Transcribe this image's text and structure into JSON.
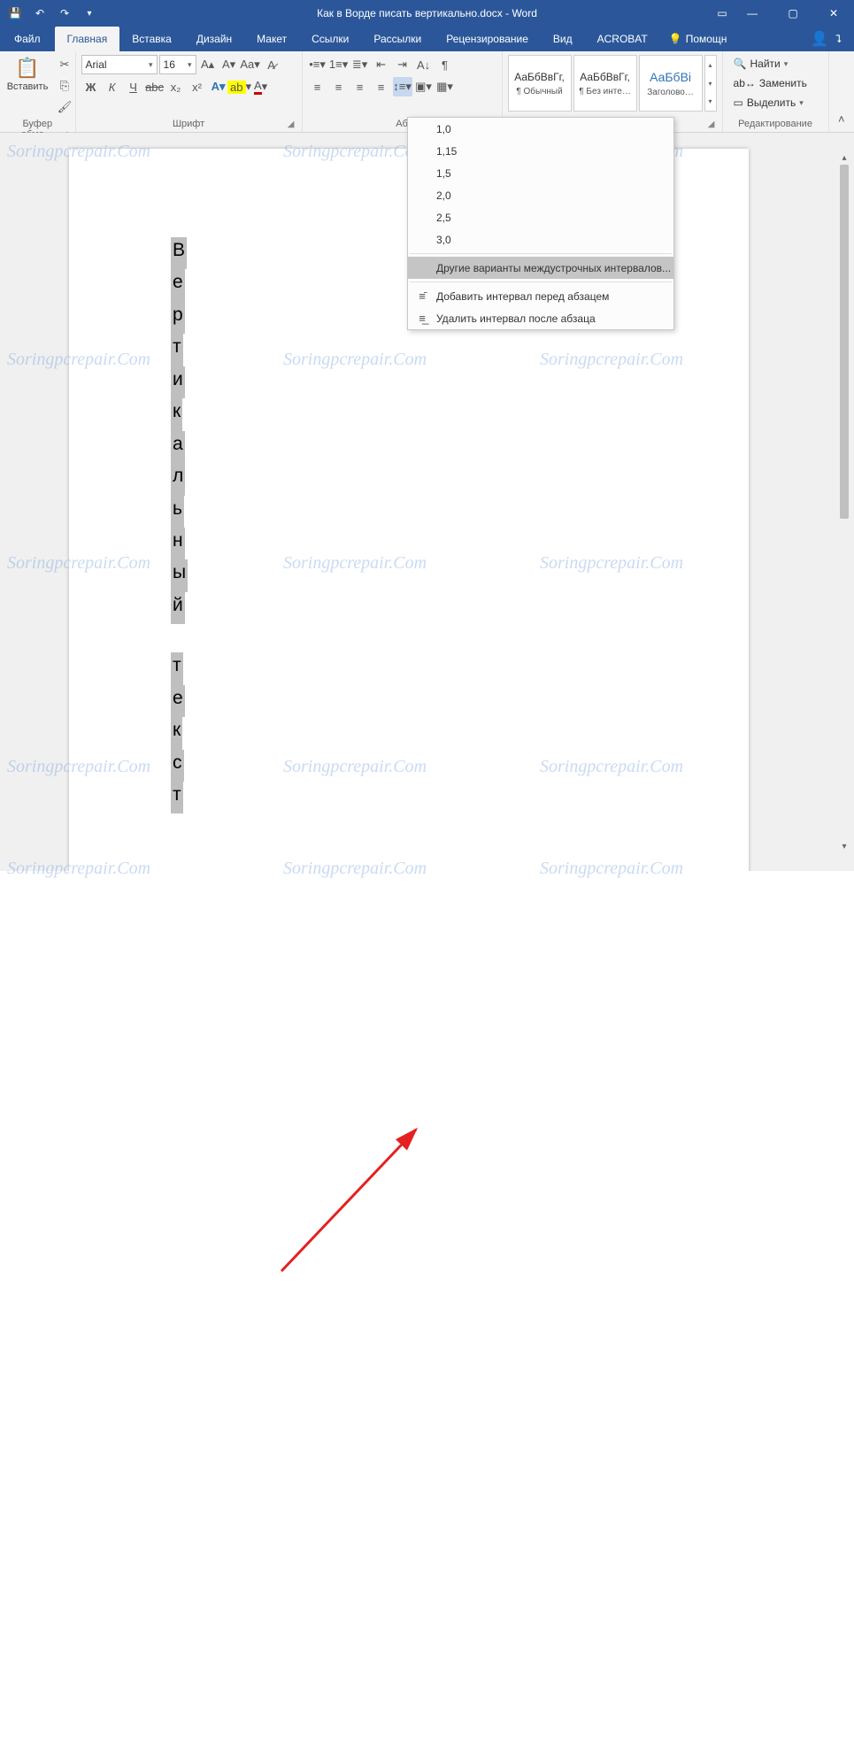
{
  "titlebar": {
    "doc_title": "Как в Ворде писать вертикально.docx - Word"
  },
  "tabs": {
    "file": "Файл",
    "home": "Главная",
    "insert": "Вставка",
    "design": "Дизайн",
    "layout": "Макет",
    "references": "Ссылки",
    "mailings": "Рассылки",
    "review": "Рецензирование",
    "view": "Вид",
    "acrobat": "ACROBAT",
    "tellme": "Помощн"
  },
  "clipboard": {
    "paste": "Вставить",
    "group_label": "Буфер обме…"
  },
  "font": {
    "name": "Arial",
    "size": "16",
    "group_label": "Шрифт",
    "bold": "Ж",
    "italic": "К",
    "underline": "Ч",
    "strike": "abc",
    "sub": "x₂",
    "sup": "x²"
  },
  "paragraph": {
    "group_label": "Аб"
  },
  "styles": {
    "preview": "АаБбВвГг,",
    "normal": "¶ Обычный",
    "nospacing": "¶ Без инте…",
    "heading1": "Заголово…"
  },
  "editing": {
    "find": "Найти",
    "replace": "Заменить",
    "select": "Выделить",
    "group_label": "Редактирование"
  },
  "line_spacing_menu": {
    "options": [
      "1,0",
      "1,15",
      "1,5",
      "2,0",
      "2,5",
      "3,0"
    ],
    "more": "Другие варианты междустрочных интервалов...",
    "add_before": "Добавить интервал перед абзацем",
    "remove_after": "Удалить интервал после абзаца"
  },
  "document": {
    "word1": [
      "В",
      "е",
      "р",
      "т",
      "и",
      "к",
      "а",
      "л",
      "ь",
      "н",
      "ы",
      "й"
    ],
    "word2": [
      "т",
      "е",
      "к",
      "с",
      "т"
    ]
  },
  "watermark_text": "Soringpcrepair.Com"
}
